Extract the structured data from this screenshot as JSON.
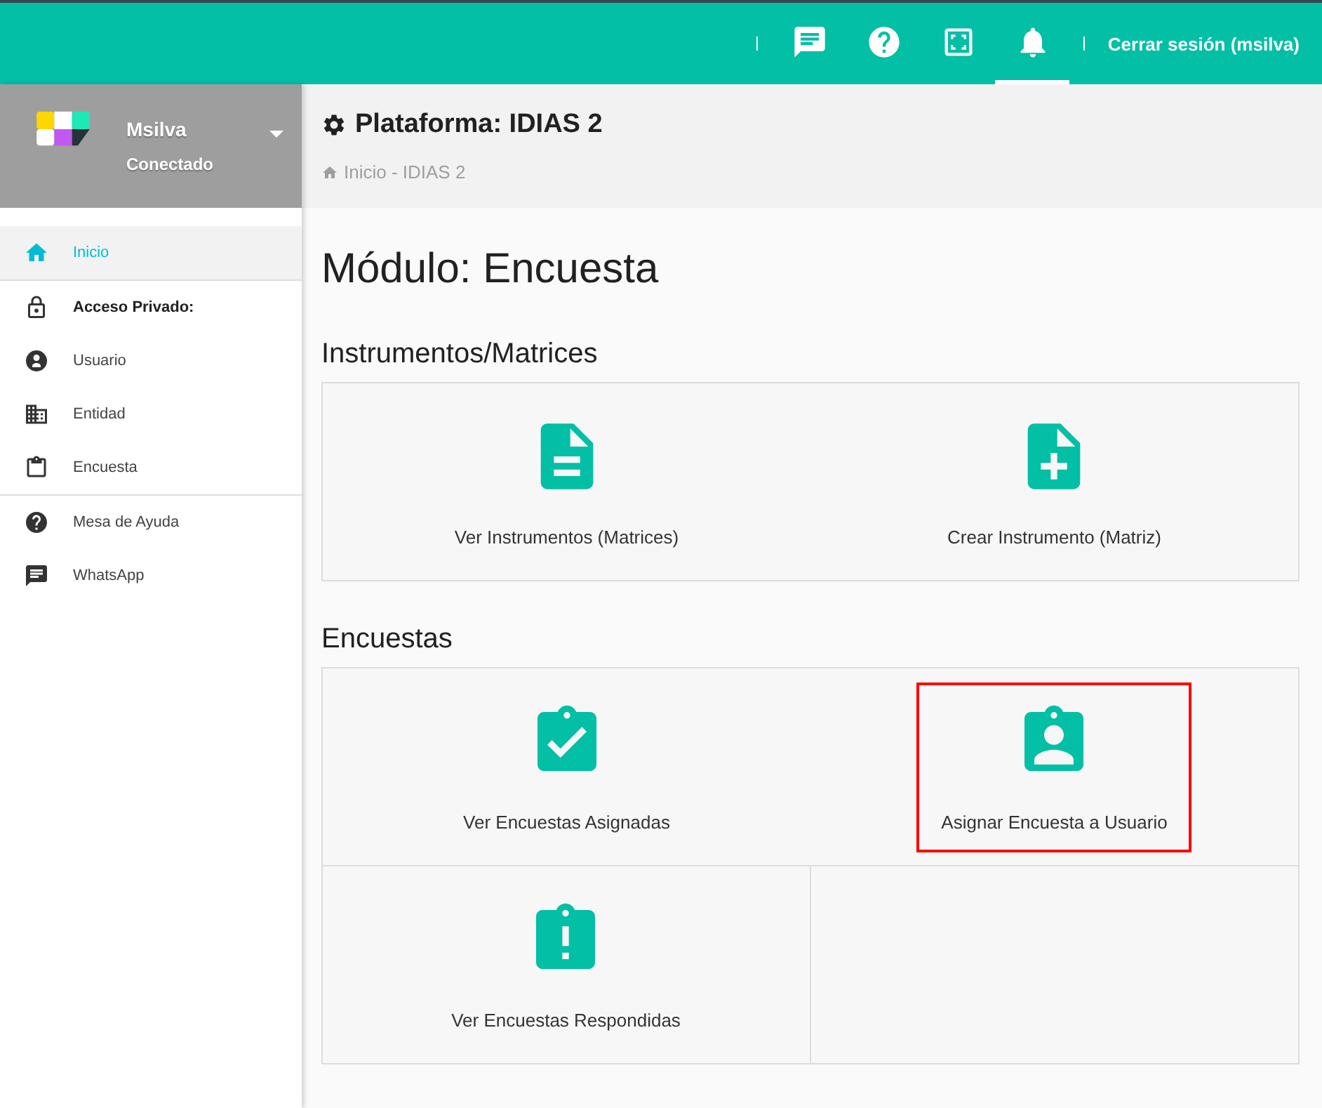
{
  "topbar": {
    "icons": [
      {
        "selected": false
      },
      {
        "selected": false
      },
      {
        "selected": false
      },
      {
        "selected": true
      }
    ],
    "logout": "Cerrar sesión (msilva)"
  },
  "user": {
    "name": "Msilva",
    "status": "Conectado"
  },
  "sidebar": {
    "items": [
      {
        "label": "Inicio",
        "kind": "link",
        "selected": true,
        "divider_after": true
      },
      {
        "label": "Acceso Privado:",
        "kind": "header",
        "selected": false,
        "divider_after": false
      },
      {
        "label": "Usuario",
        "kind": "link",
        "selected": false,
        "divider_after": false
      },
      {
        "label": "Entidad",
        "kind": "link",
        "selected": false,
        "divider_after": false
      },
      {
        "label": "Encuesta",
        "kind": "link",
        "selected": false,
        "divider_after": true
      },
      {
        "label": "Mesa de Ayuda",
        "kind": "link",
        "selected": false,
        "divider_after": false
      },
      {
        "label": "WhatsApp",
        "kind": "link",
        "selected": false,
        "divider_after": false
      }
    ]
  },
  "header": {
    "title": "Plataforma: IDIAS 2",
    "breadcrumb": "Inicio - IDIAS 2"
  },
  "page_title": "Módulo: Encuesta",
  "sections": [
    {
      "title": "Instrumentos/Matrices",
      "tiles": [
        {
          "label": "Ver Instrumentos (Matrices)",
          "highlighted": false
        },
        {
          "label": "Crear Instrumento (Matriz)",
          "highlighted": false
        }
      ]
    },
    {
      "title": "Encuestas",
      "tiles": [
        {
          "label": "Ver Encuestas Asignadas",
          "highlighted": false
        },
        {
          "label": "Asignar Encuesta a Usuario",
          "highlighted": true
        },
        {
          "label": "Ver Encuestas Respondidas",
          "highlighted": false
        }
      ]
    }
  ]
}
